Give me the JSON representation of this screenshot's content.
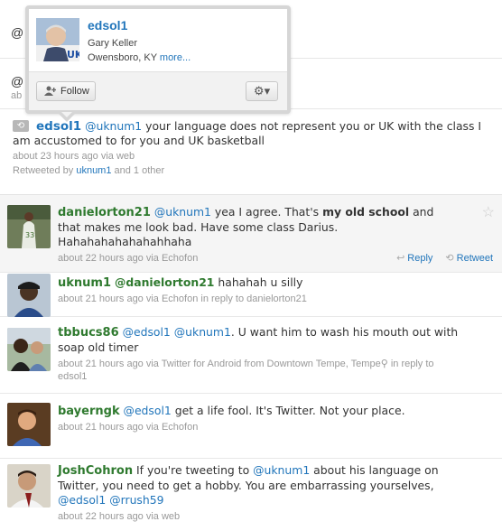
{
  "top_stub": {
    "text": ""
  },
  "peek1": {
    "at": "@"
  },
  "peek2": {
    "at": "@",
    "meta": "ab"
  },
  "hovercard": {
    "handle": "edsol1",
    "name": "Gary Keller",
    "location": "Owensboro, KY",
    "more": "more...",
    "follow_label": "Follow",
    "gear_caret": "▾"
  },
  "tweets": [
    {
      "user": "edsol1",
      "mention": "@uknum1",
      "text": " your language does not represent you or UK with the class I am accustomed to for you and UK basketball",
      "meta": "about 23 hours ago via web",
      "retweeted_prefix": "Retweeted by ",
      "retweeted_user": "uknum1",
      "retweeted_suffix": " and 1 other"
    },
    {
      "user": "danielorton21",
      "mention": "@uknum1",
      "text_a": " yea I agree. That's ",
      "bold": "my old school",
      "text_b": " and that makes me look bad. Have some class Darius. Hahahahahahahahhaha",
      "meta": "about 22 hours ago via Echofon",
      "reply": "Reply",
      "retweet": "Retweet"
    },
    {
      "user": "uknum1",
      "mention": "@danielorton21",
      "text": " hahahah u silly",
      "meta_a": "about 21 hours ago via Echofon ",
      "meta_b": "in reply to danielorton21"
    },
    {
      "user": "tbbucs86",
      "mention1": "@edsol1",
      "mention2": "@uknum1",
      "text": ". U want him to wash his mouth out with soap old timer",
      "meta_a": "about 21 hours ago via Twitter for Android from Downtown Tempe, Tempe",
      "meta_b": " in reply to",
      "meta_c": "edsol1"
    },
    {
      "user": "bayerngk",
      "mention": "@edsol1",
      "text": " get a life fool. It's Twitter. Not your place.",
      "meta": "about 21 hours ago via Echofon"
    },
    {
      "user": "JoshCohron",
      "text_a": " If you're tweeting to ",
      "mention1": "@uknum1",
      "text_b": " about his language on Twitter, you need to get a hobby. You are embarrassing yourselves, ",
      "mention2": "@edsol1",
      "mention3": "@rrush59",
      "meta": "about 22 hours ago via web"
    }
  ],
  "colors": {
    "link": "#2276bb",
    "username_green": "#2f7a2f",
    "meta": "#999999"
  },
  "icons": [
    "retweet-icon",
    "follow-person-icon",
    "gear-icon",
    "star-icon",
    "reply-icon",
    "location-pin-icon"
  ]
}
